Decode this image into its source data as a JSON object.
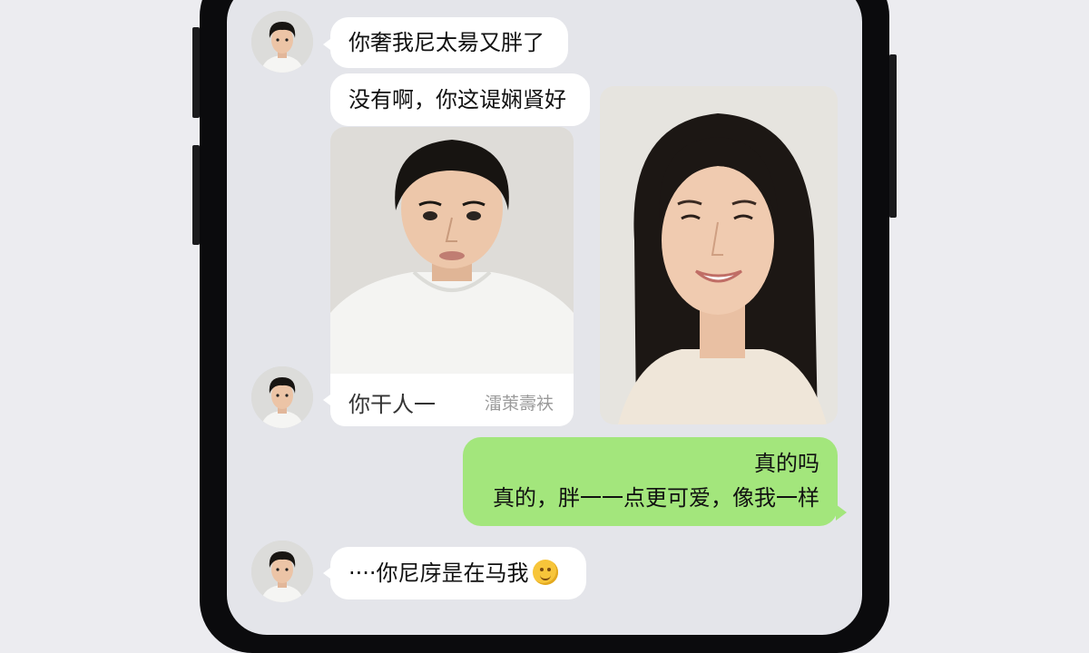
{
  "chat": {
    "messages": [
      {
        "side": "left",
        "text": "你奢我尼太昜又胖了"
      },
      {
        "side": "left",
        "text": "没有啊，你这𬤊娴䝨好"
      },
      {
        "side": "left",
        "type": "photo",
        "caption_left": "你干人一",
        "caption_right": "㵢茦壽衭"
      },
      {
        "side": "left",
        "type": "photo",
        "subject": "smiling woman"
      },
      {
        "side": "right",
        "lines": [
          "真的吗",
          "真的，胖一一点更可爱，像我一样"
        ]
      },
      {
        "side": "left",
        "text": "····你尼庌昰在马我",
        "emoji": "smiling-face"
      }
    ]
  },
  "colors": {
    "screen_bg": "#e4e5ea",
    "received_bubble": "#ffffff",
    "sent_bubble": "#a3e67c",
    "frame": "#0b0b0d"
  }
}
